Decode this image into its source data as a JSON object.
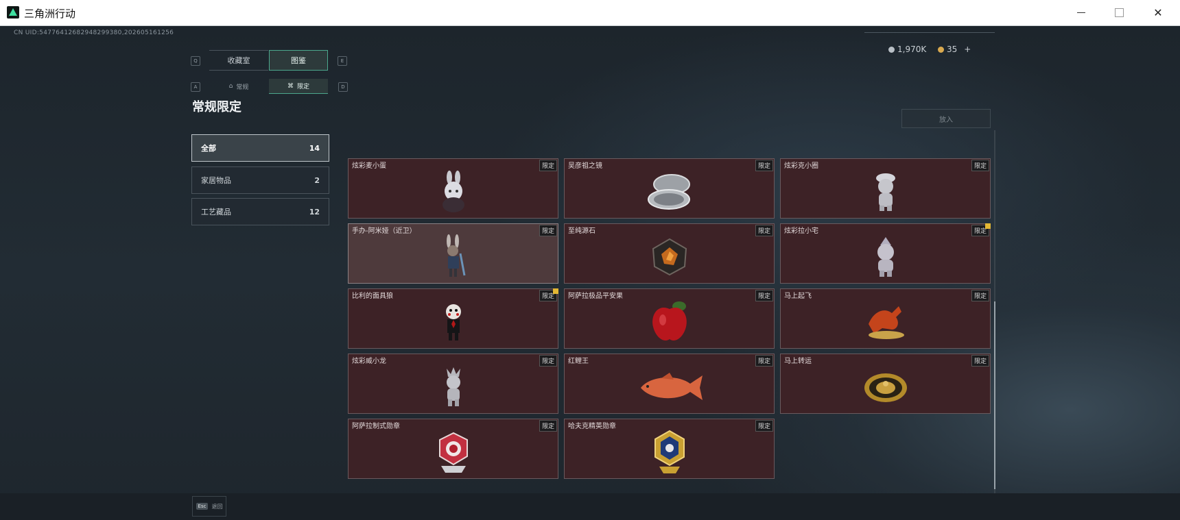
{
  "window": {
    "title": "三角洲行动"
  },
  "header": {
    "uid": "CN UID:54776412682948299380,202605161256",
    "currency_1": "1,970K",
    "currency_2": "35",
    "currency_plus": "+"
  },
  "tabs": {
    "key_left": "Q",
    "key_right": "E",
    "collection": "收藏室",
    "catalog": "图鉴"
  },
  "subtabs": {
    "key_left": "A",
    "key_right": "D",
    "regular": "常规",
    "limited": "限定"
  },
  "section_title": "常规限定",
  "categories": [
    {
      "label": "全部",
      "count": "14"
    },
    {
      "label": "家居物品",
      "count": "2"
    },
    {
      "label": "工艺藏品",
      "count": "12"
    }
  ],
  "put_button": "放入",
  "items": [
    {
      "name": "炫彩麦小蛋",
      "tag": "限定"
    },
    {
      "name": "吴彦祖之镜",
      "tag": "限定"
    },
    {
      "name": "炫彩克小圈",
      "tag": "限定"
    },
    {
      "name": "手办-阿米娅（近卫）",
      "tag": "限定"
    },
    {
      "name": "至纯源石",
      "tag": "限定"
    },
    {
      "name": "炫彩拉小宅",
      "tag": "限定"
    },
    {
      "name": "比利的面具狼",
      "tag": "限定"
    },
    {
      "name": "阿萨拉极品平安果",
      "tag": "限定"
    },
    {
      "name": "马上起飞",
      "tag": "限定"
    },
    {
      "name": "炫彩威小龙",
      "tag": "限定"
    },
    {
      "name": "红鲤王",
      "tag": "限定"
    },
    {
      "name": "马上转运",
      "tag": "限定"
    },
    {
      "name": "阿萨拉制式勋章",
      "tag": "限定"
    },
    {
      "name": "哈夫克精英勋章",
      "tag": "限定"
    }
  ],
  "footer": {
    "esc_key": "Esc",
    "esc_label": "退回"
  },
  "colors": {
    "card_bg": "#3d2226",
    "accent": "#4ca88d",
    "badge": "#e4b734"
  }
}
